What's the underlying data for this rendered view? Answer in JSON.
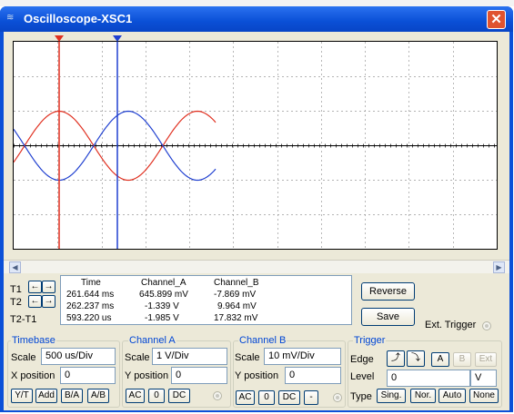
{
  "window": {
    "title": "Oscilloscope-XSC1",
    "close_glyph": "✕",
    "icon": "oscilloscope-icon"
  },
  "readout": {
    "labels": {
      "t1": "T1",
      "t2": "T2",
      "t2_t1": "T2-T1"
    },
    "headers": {
      "time": "Time",
      "channel_a": "Channel_A",
      "channel_b": "Channel_B"
    },
    "rows": [
      {
        "time": "261.644 ms",
        "a": "645.899 mV",
        "b": "-7.869 mV"
      },
      {
        "time": "262.237 ms",
        "a": "-1.339 V",
        "b": "9.964 mV"
      },
      {
        "time": "593.220 us",
        "a": "-1.985 V",
        "b": "17.832 mV"
      }
    ]
  },
  "buttons": {
    "reverse": "Reverse",
    "save": "Save",
    "ext_trigger": "Ext. Trigger"
  },
  "timebase": {
    "title": "Timebase",
    "scale_label": "Scale",
    "scale": "500 us/Div",
    "xpos_label": "X position",
    "xpos": "0",
    "modes": [
      "Y/T",
      "Add",
      "B/A",
      "A/B"
    ]
  },
  "channel_a": {
    "title": "Channel A",
    "scale_label": "Scale",
    "scale": "1  V/Div",
    "ypos_label": "Y position",
    "ypos": "0",
    "coupling": [
      "AC",
      "0",
      "DC"
    ]
  },
  "channel_b": {
    "title": "Channel B",
    "scale_label": "Scale",
    "scale": "10 mV/Div",
    "ypos_label": "Y position",
    "ypos": "0",
    "coupling": [
      "AC",
      "0",
      "DC",
      "-"
    ]
  },
  "trigger": {
    "title": "Trigger",
    "edge_label": "Edge",
    "level_label": "Level",
    "level": "0",
    "level_unit": "V",
    "source": [
      "A",
      "B",
      "Ext"
    ],
    "selected_source": "A",
    "type_label": "Type",
    "types": [
      "Sing.",
      "Nor.",
      "Auto",
      "None"
    ],
    "selected_type": "None"
  },
  "colors": {
    "channel_a": "#e03020",
    "channel_b": "#2040d0",
    "cursor_t1": "#e03020",
    "cursor_t2": "#2040d0"
  }
}
